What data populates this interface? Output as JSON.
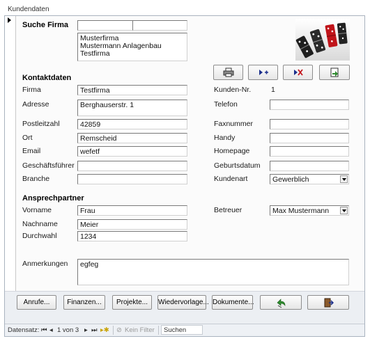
{
  "window": {
    "title": "Kundendaten"
  },
  "search": {
    "heading": "Suche Firma",
    "input1_value": "",
    "input2_value": "",
    "list_items": [
      "Musterfirma",
      "Mustermann Anlagenbau",
      "Testfirma"
    ]
  },
  "toolbar": {
    "print_icon": "printer-icon",
    "new_icon": "new-record-icon",
    "delete_icon": "delete-record-icon",
    "export_icon": "export-icon"
  },
  "contact": {
    "heading": "Kontaktdaten",
    "firma_label": "Firma",
    "firma_value": "Testfirma",
    "adresse_label": "Adresse",
    "adresse_value": "Berghauserstr. 1",
    "plz_label": "Postleitzahl",
    "plz_value": "42859",
    "ort_label": "Ort",
    "ort_value": "Remscheid",
    "email_label": "Email",
    "email_value": "wefetf",
    "gf_label": "Geschäftsführer",
    "gf_value": "",
    "branche_label": "Branche",
    "branche_value": "",
    "kundennr_label": "Kunden-Nr.",
    "kundennr_value": "1",
    "telefon_label": "Telefon",
    "telefon_value": "",
    "fax_label": "Faxnummer",
    "fax_value": "",
    "handy_label": "Handy",
    "handy_value": "",
    "homepage_label": "Homepage",
    "homepage_value": "",
    "geburtsdatum_label": "Geburtsdatum",
    "geburtsdatum_value": "",
    "kundenart_label": "Kundenart",
    "kundenart_value": "Gewerblich"
  },
  "partner": {
    "heading": "Ansprechpartner",
    "vorname_label": "Vorname",
    "vorname_value": "Frau",
    "nachname_label": "Nachname",
    "nachname_value": "Meier",
    "durchwahl_label": "Durchwahl",
    "durchwahl_value": "1234",
    "betreuer_label": "Betreuer",
    "betreuer_value": "Max Mustermann"
  },
  "notes": {
    "label": "Anmerkungen",
    "value": "egfeg"
  },
  "buttons": {
    "anrufe": "Anrufe...",
    "finanzen": "Finanzen...",
    "projekte": "Projekte...",
    "wiedervorlage": "Wiedervorlage...",
    "dokumente": "Dokumente..."
  },
  "navigation": {
    "record_label": "Datensatz:",
    "position": "1 von 3",
    "filter_label": "Kein Filter",
    "search_label": "Suchen"
  }
}
